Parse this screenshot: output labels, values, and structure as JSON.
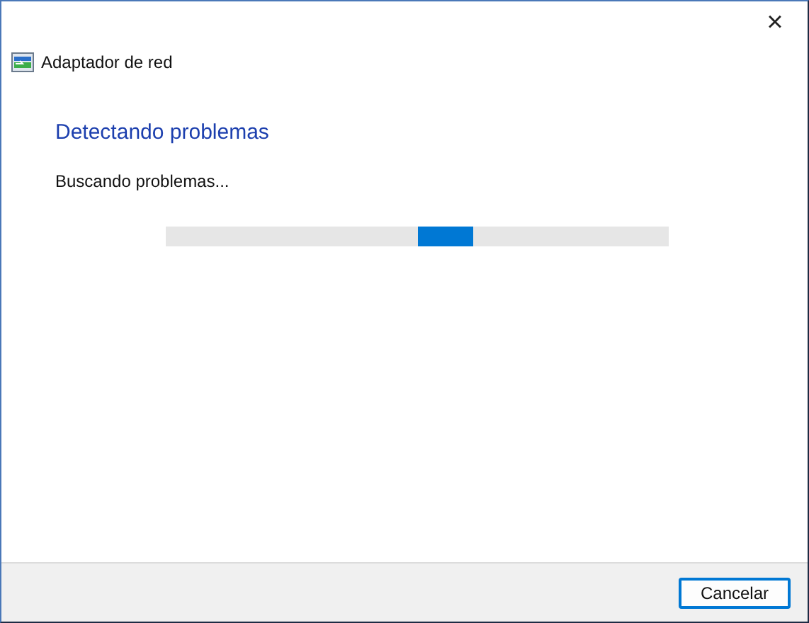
{
  "window": {
    "title": "Adaptador de red",
    "close": "×"
  },
  "heading": "Detectando problemas",
  "status": "Buscando problemas...",
  "progress": {
    "indeterminate": true
  },
  "buttons": [
    {
      "label": "Cancelar",
      "default": true
    }
  ]
}
